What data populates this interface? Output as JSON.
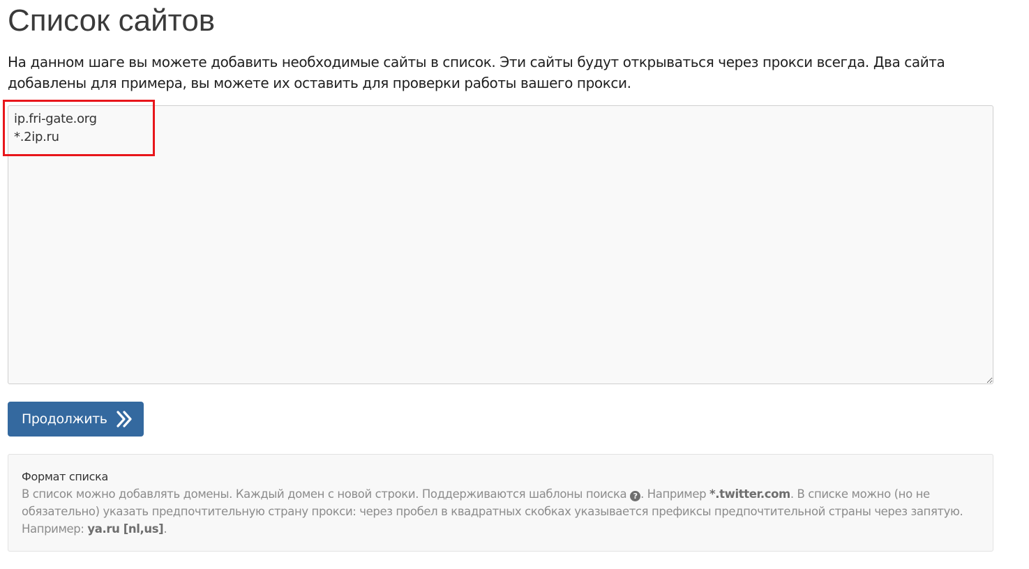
{
  "page": {
    "title": "Список сайтов",
    "intro": "На данном шаге вы можете добавить необходимые сайты в список. Эти сайты будут открываться через прокси всегда. Два сайта добавлены для примера, вы можете их оставить для проверки работы вашего прокси."
  },
  "sites_textarea": {
    "value": "ip.fri-gate.org\n*.2ip.ru"
  },
  "continue_button": {
    "label": "Продолжить",
    "icon": "double-chevron-right-icon"
  },
  "info": {
    "title": "Формат списка",
    "text_part1": "В список можно добавлять домены. Каждый домен с новой строки. Поддерживаются шаблоны поиска",
    "help_icon_glyph": "?",
    "text_part2": ". Например",
    "example1": "*.twitter.com",
    "text_part3": ". В списке можно (но не обязательно) указать предпочтительную страну прокси: через пробел в квадратных скобках указывается префиксы предпочтительной страны через запятую. Например:",
    "example2": "ya.ru [nl,us]",
    "text_part4": "."
  },
  "colors": {
    "button_bg": "#34699f",
    "highlight_border": "#e8161b",
    "textarea_bg": "#f9f9f9",
    "info_bg": "#f8f8f8"
  }
}
